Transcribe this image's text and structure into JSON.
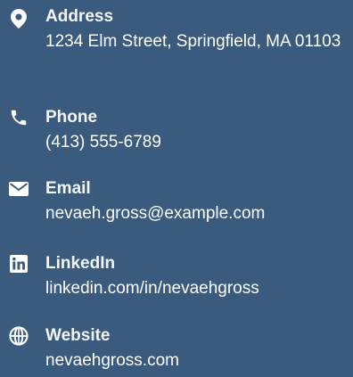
{
  "contacts": {
    "address": {
      "icon": "map-marker-icon",
      "label": "Address",
      "value": "1234 Elm Street, Springfield, MA 01103"
    },
    "phone": {
      "icon": "phone-icon",
      "label": "Phone",
      "value": "(413) 555-6789"
    },
    "email": {
      "icon": "envelope-icon",
      "label": "Email",
      "value": "nevaeh.gross@example.com"
    },
    "linkedin": {
      "icon": "linkedin-icon",
      "label": "LinkedIn",
      "value": "linkedin.com/in/nevaehgross"
    },
    "website": {
      "icon": "globe-icon",
      "label": "Website",
      "value": "nevaehgross.com"
    }
  },
  "colors": {
    "background": "#3a5a7e",
    "text": "#ffffff"
  }
}
